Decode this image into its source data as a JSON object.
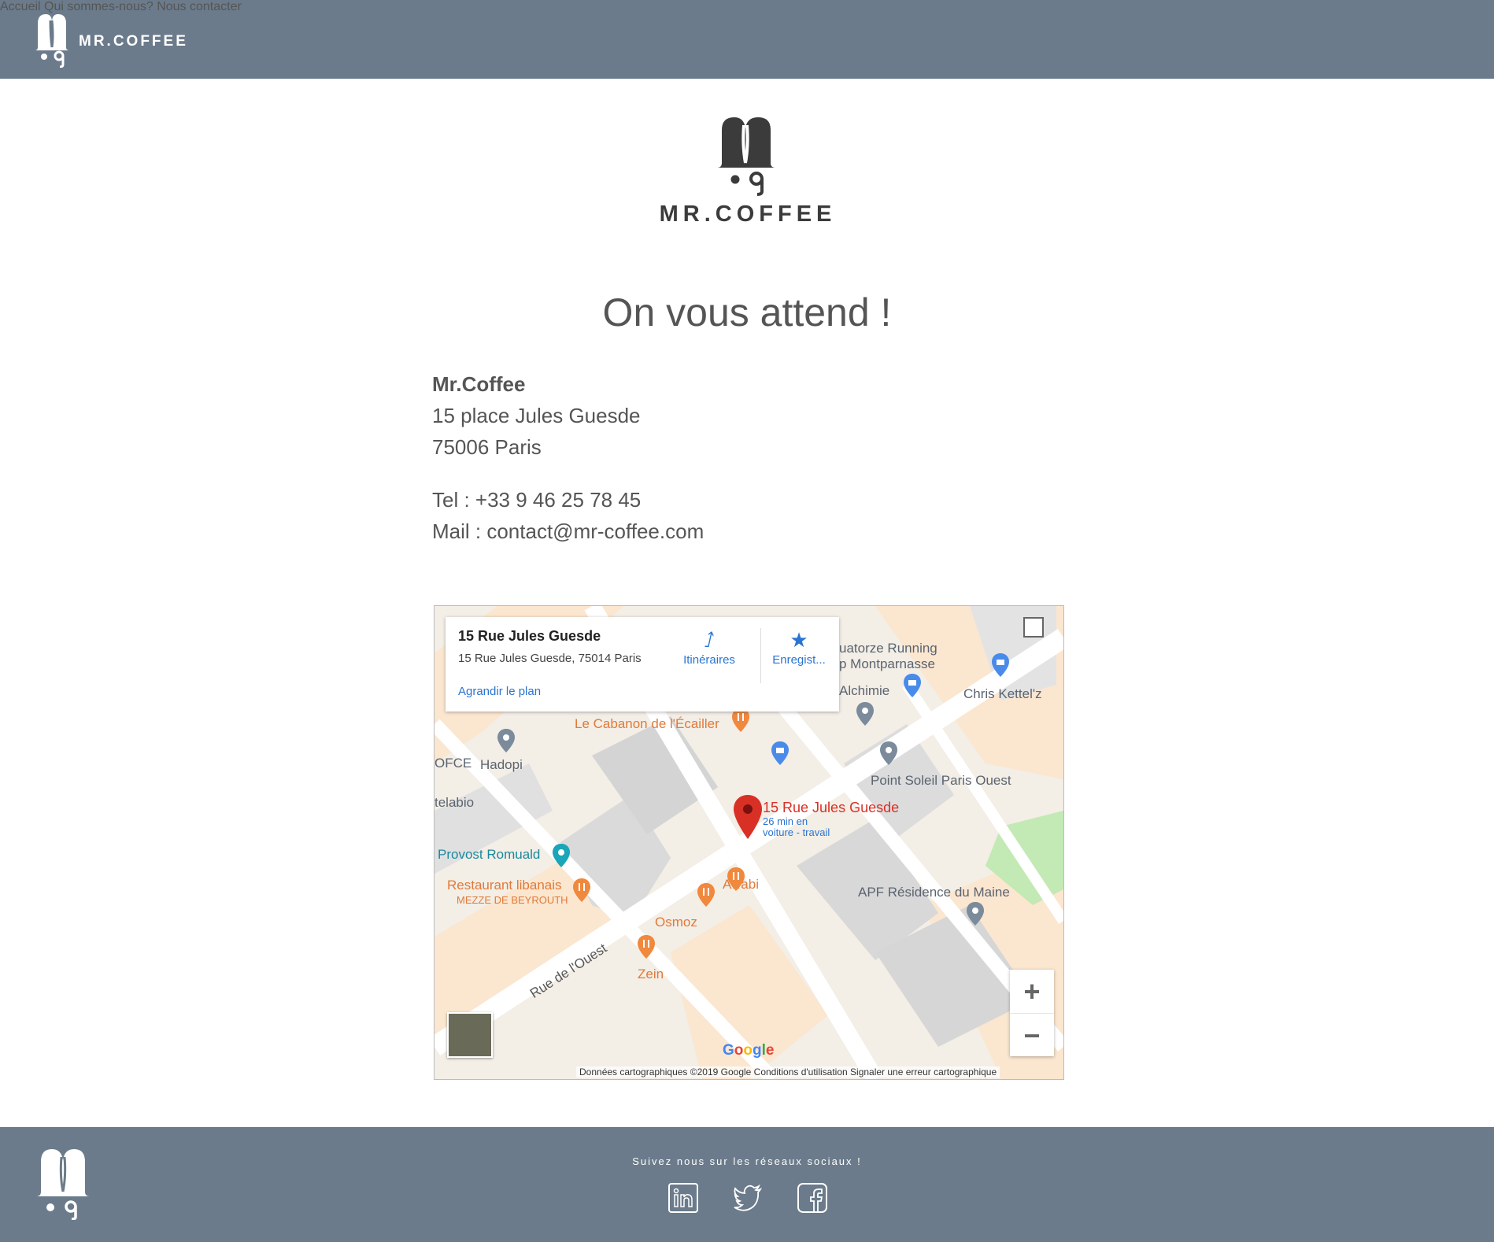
{
  "header": {
    "brand": "MR.COFFEE",
    "nav": [
      {
        "label": "Accueil"
      },
      {
        "label": "Qui sommes-nous?"
      },
      {
        "label": "Nous contacter"
      }
    ]
  },
  "main": {
    "brand": "MR.COFFEE",
    "title": "On vous attend !",
    "address": {
      "name": "Mr.Coffee",
      "street": "15 place Jules Guesde",
      "city": "75006 Paris"
    },
    "contact": {
      "tel": "Tel : +33 9 46 25 78 45",
      "mail": "Mail : contact@mr-coffee.com"
    }
  },
  "map": {
    "card_title": "15 Rue Jules Guesde",
    "card_address": "15 Rue Jules Guesde, 75014 Paris",
    "card_link": "Agrandir le plan",
    "directions_label": "Itinéraires",
    "save_label": "Enregist...",
    "marker_title": "15 Rue Jules Guesde",
    "marker_sub1": "26 min en",
    "marker_sub2": "voiture - travail",
    "pois": {
      "cabanon": "Le Cabanon de l'Écailler",
      "hadopi": "Hadopi",
      "ofce": "OFCE",
      "telabio": "telabio",
      "provost": "Provost Romuald",
      "restaurant": "Restaurant libanais",
      "mezze": "MEZZE DE BEYROUTH",
      "awabi": "Awabi",
      "osmoz": "Osmoz",
      "zein": "Zein",
      "quatorze": "uatorze Running",
      "montparnasse": "p Montparnasse",
      "alchimie": "Alchimie",
      "kettel": "Chris Kettel'z",
      "soleil": "Point Soleil Paris Ouest",
      "apf": "APF Résidence du Maine",
      "rue_ouest": "Rue de l'Ouest"
    },
    "google": "Google",
    "attribution": "Données cartographiques ©2019 Google   Conditions d'utilisation   Signaler une erreur cartographique",
    "zoom_in": "+",
    "zoom_out": "−"
  },
  "footer": {
    "follow_text": "Suivez nous sur les réseaux sociaux !",
    "social": [
      "linkedin-icon",
      "twitter-icon",
      "facebook-icon"
    ]
  },
  "colors": {
    "header_bg": "#6b7b8b",
    "footer_bg": "#6b7b8b",
    "map_link": "#2a74d2",
    "marker": "#d93025"
  }
}
